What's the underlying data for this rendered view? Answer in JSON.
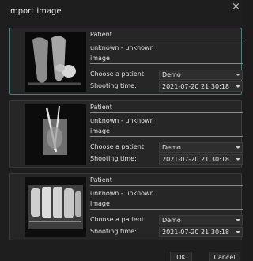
{
  "dialog": {
    "title": "Import image",
    "close_glyph": "×"
  },
  "labels": {
    "choose_patient": "Choose a patient:",
    "shooting_time": "Shooting time:"
  },
  "cards": [
    {
      "section": "Patient",
      "name": "unknown - unknown",
      "type": "image",
      "patient": "Demo",
      "time": "2021-07-20 21:30:18",
      "selected": true
    },
    {
      "section": "Patient",
      "name": "unknown - unknown",
      "type": "image",
      "patient": "Demo",
      "time": "2021-07-20 21:30:18",
      "selected": false
    },
    {
      "section": "Patient",
      "name": "unknown - unknown",
      "type": "image",
      "patient": "Demo",
      "time": "2021-07-20 21:30:18",
      "selected": false
    }
  ],
  "buttons": {
    "ok": "OK",
    "cancel": "Cancel"
  },
  "colors": {
    "selected_border": "#2c8c83",
    "background": "#1e1e1e"
  }
}
